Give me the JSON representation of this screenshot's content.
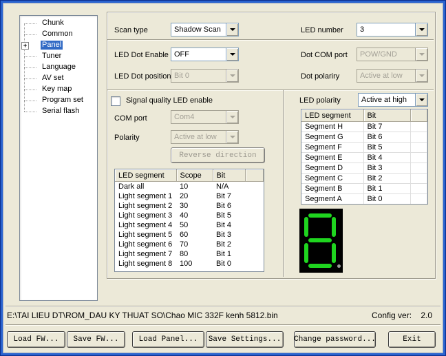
{
  "colors": {
    "window_bg": "#ece9d8",
    "frame_blue": "#2a63cf",
    "selection_blue": "#316ac5",
    "disabled_text": "#a3a096",
    "segment_lit": "#1fd51f",
    "segment_unlit": "#9a9a9a",
    "display_bg": "#000000"
  },
  "tree": {
    "items": [
      {
        "label": "Chunk"
      },
      {
        "label": "Common"
      },
      {
        "label": "Panel"
      },
      {
        "label": "Tuner"
      },
      {
        "label": "Language"
      },
      {
        "label": "AV set"
      },
      {
        "label": "Key map"
      },
      {
        "label": "Program set"
      },
      {
        "label": "Serial flash"
      }
    ],
    "selected": "Panel",
    "expander_glyph": "+"
  },
  "scan": {
    "scan_type_label": "Scan type",
    "scan_type_value": "Shadow Scan",
    "led_number_label": "LED number",
    "led_number_value": "3"
  },
  "dot": {
    "enable_label": "LED Dot Enable",
    "enable_value": "OFF",
    "com_label": "Dot COM port",
    "com_value": "POW/GND",
    "position_label": "LED Dot position",
    "position_value": "Bit 0",
    "polarity_label": "Dot polariry",
    "polarity_value": "Active at low"
  },
  "signal": {
    "checkbox_label": "Signal quality LED enable",
    "checked": false,
    "com_label": "COM port",
    "com_value": "Com4",
    "polarity_label": "Polarity",
    "polarity_value": "Active at low",
    "reverse_button_label": "Reverse direction"
  },
  "scope_table": {
    "headers": [
      "LED segment",
      "Scope",
      "Bit",
      ""
    ],
    "rows": [
      {
        "segment": "Dark all",
        "scope": "10",
        "bit": "N/A"
      },
      {
        "segment": "Light segment 1",
        "scope": "20",
        "bit": "Bit 7"
      },
      {
        "segment": "Light segment 2",
        "scope": "30",
        "bit": "Bit 6"
      },
      {
        "segment": "Light segment 3",
        "scope": "40",
        "bit": "Bit 5"
      },
      {
        "segment": "Light segment 4",
        "scope": "50",
        "bit": "Bit 4"
      },
      {
        "segment": "Light segment 5",
        "scope": "60",
        "bit": "Bit 3"
      },
      {
        "segment": "Light segment 6",
        "scope": "70",
        "bit": "Bit 2"
      },
      {
        "segment": "Light segment 7",
        "scope": "80",
        "bit": "Bit 1"
      },
      {
        "segment": "Light segment 8",
        "scope": "100",
        "bit": "Bit 0"
      }
    ]
  },
  "led_polarity": {
    "label": "LED polarity",
    "value": "Active at high"
  },
  "segment_table": {
    "headers": [
      "LED segment",
      "Bit",
      ""
    ],
    "rows": [
      {
        "segment": "Segment H",
        "bit": "Bit 7"
      },
      {
        "segment": "Segment G",
        "bit": "Bit 6"
      },
      {
        "segment": "Segment F",
        "bit": "Bit 5"
      },
      {
        "segment": "Segment E",
        "bit": "Bit 4"
      },
      {
        "segment": "Segment D",
        "bit": "Bit 3"
      },
      {
        "segment": "Segment C",
        "bit": "Bit 2"
      },
      {
        "segment": "Segment B",
        "bit": "Bit 1"
      },
      {
        "segment": "Segment A",
        "bit": "Bit 0"
      }
    ]
  },
  "seven_segment": {
    "states": {
      "A": true,
      "B": true,
      "C": true,
      "D": true,
      "E": true,
      "F": true,
      "G": true,
      "DP": false
    },
    "lit_color": "#1fd51f",
    "unlit_color": "#9a9a9a",
    "bg": "#000000"
  },
  "footer": {
    "path": "E:\\TAI LIEU DT\\ROM_DAU KY THUAT SO\\Chao MIC 332F kenh 5812.bin",
    "config_label": "Config ver:",
    "config_value": "2.0",
    "buttons": [
      "Load FW...",
      "Save FW...",
      "Load Panel...",
      "Save Settings...",
      "Change password...",
      "Exit"
    ]
  }
}
